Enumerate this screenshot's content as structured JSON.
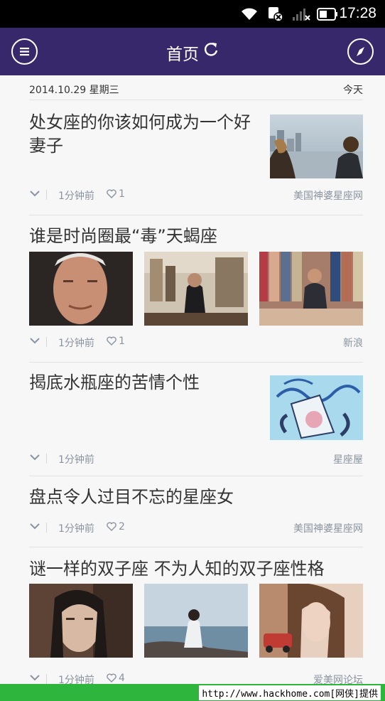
{
  "status_bar": {
    "time": "17:28"
  },
  "header": {
    "title": "首页"
  },
  "date_line": {
    "date": "2014.10.29 星期三",
    "today": "今天"
  },
  "articles": [
    {
      "title": "处女座的你该如何成为一个好妻子",
      "ago": "1分钟前",
      "likes": "1",
      "source": "美国神婆星座网"
    },
    {
      "title": "谁是时尚圈最“毒”天蝎座",
      "ago": "1分钟前",
      "likes": "1",
      "source": "新浪"
    },
    {
      "title": "揭底水瓶座的苦情个性",
      "ago": "1分钟前",
      "source": "星座屋"
    },
    {
      "title": "盘点令人过目不忘的星座女",
      "ago": "1分钟前",
      "likes": "2",
      "source": "美国神婆星座网"
    },
    {
      "title": "谜一样的双子座 不为人知的双子座性格",
      "ago": "1分钟前",
      "likes": "4",
      "source": "爱美网论坛"
    }
  ],
  "watermark": "http://www.hackhome.com[网侠]提供",
  "colors": {
    "header_bg": "#37276b",
    "meta_text": "#8a93a0",
    "bottom_bar": "#2eb53e"
  }
}
